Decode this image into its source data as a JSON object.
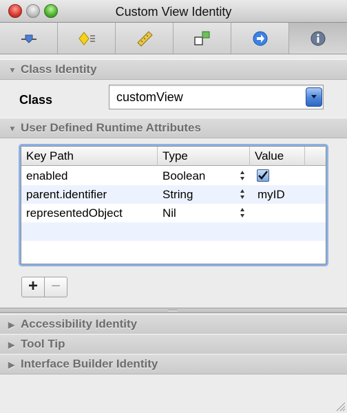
{
  "window": {
    "title": "Custom View Identity"
  },
  "toolbar": {
    "tabs": [
      {
        "icon": "attributes-slider-icon"
      },
      {
        "icon": "bindings-diamond-icon"
      },
      {
        "icon": "ruler-size-icon"
      },
      {
        "icon": "connections-icon"
      },
      {
        "icon": "arrow-circle-icon"
      },
      {
        "icon": "info-icon",
        "selected": true
      }
    ]
  },
  "sections": {
    "class_identity": "Class Identity",
    "runtime_attributes": "User Defined Runtime Attributes",
    "accessibility": "Accessibility Identity",
    "tooltip": "Tool Tip",
    "ib_identity": "Interface Builder Identity"
  },
  "class_identity": {
    "label": "Class",
    "value": "customView"
  },
  "attributes_table": {
    "columns": [
      "Key Path",
      "Type",
      "Value"
    ],
    "rows": [
      {
        "key_path": "enabled",
        "type": "Boolean",
        "value": "",
        "checked": true
      },
      {
        "key_path": "parent.identifier",
        "type": "String",
        "value": "myID"
      },
      {
        "key_path": "representedObject",
        "type": "Nil",
        "value": ""
      }
    ]
  },
  "buttons": {
    "add": "+",
    "remove": "−"
  },
  "colors": {
    "accent": "#4d86d8",
    "selection_ring": "#8eb1e4",
    "alt_row": "#edf3fe"
  }
}
